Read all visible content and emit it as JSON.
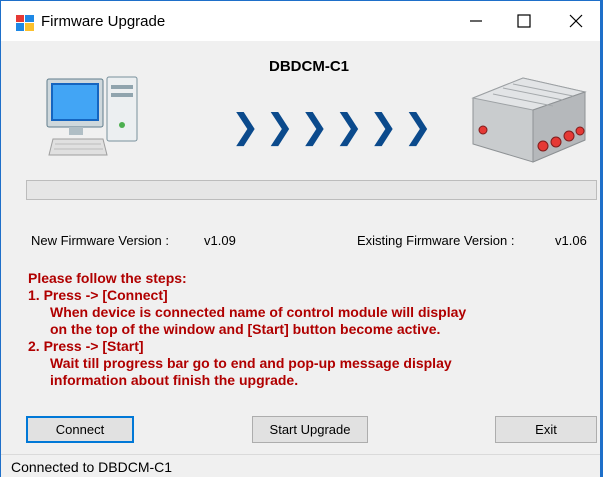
{
  "window": {
    "title": "Firmware Upgrade",
    "controls": {
      "minimize": "—",
      "maximize": "☐",
      "close": "✕"
    }
  },
  "device": {
    "name": "DBDCM-C1",
    "arrows": [
      "❯",
      "❯",
      "❯",
      "❯",
      "❯",
      "❯"
    ]
  },
  "progress": {
    "value": 0
  },
  "versions": {
    "new_label": "New Firmware Version :",
    "new_value": "v1.09",
    "existing_label": "Existing Firmware Version :",
    "existing_value": "v1.06"
  },
  "instructions": {
    "heading": "Please follow the steps:",
    "step1": "1. Press -> [Connect]",
    "step1_line1": "When device is connected name of control module will display",
    "step1_line2": "on the top of the window and [Start] button become active.",
    "step2": "2. Press -> [Start]",
    "step2_line1": "Wait till progress bar go to end and pop-up message display",
    "step2_line2": "information about finish the upgrade."
  },
  "buttons": {
    "connect": "Connect",
    "start": "Start Upgrade",
    "exit": "Exit"
  },
  "status": {
    "text": "Connected to DBDCM-C1"
  },
  "colors": {
    "accent": "#0078d7",
    "instruction_text": "#b00000",
    "arrow": "#0b4a8c"
  }
}
